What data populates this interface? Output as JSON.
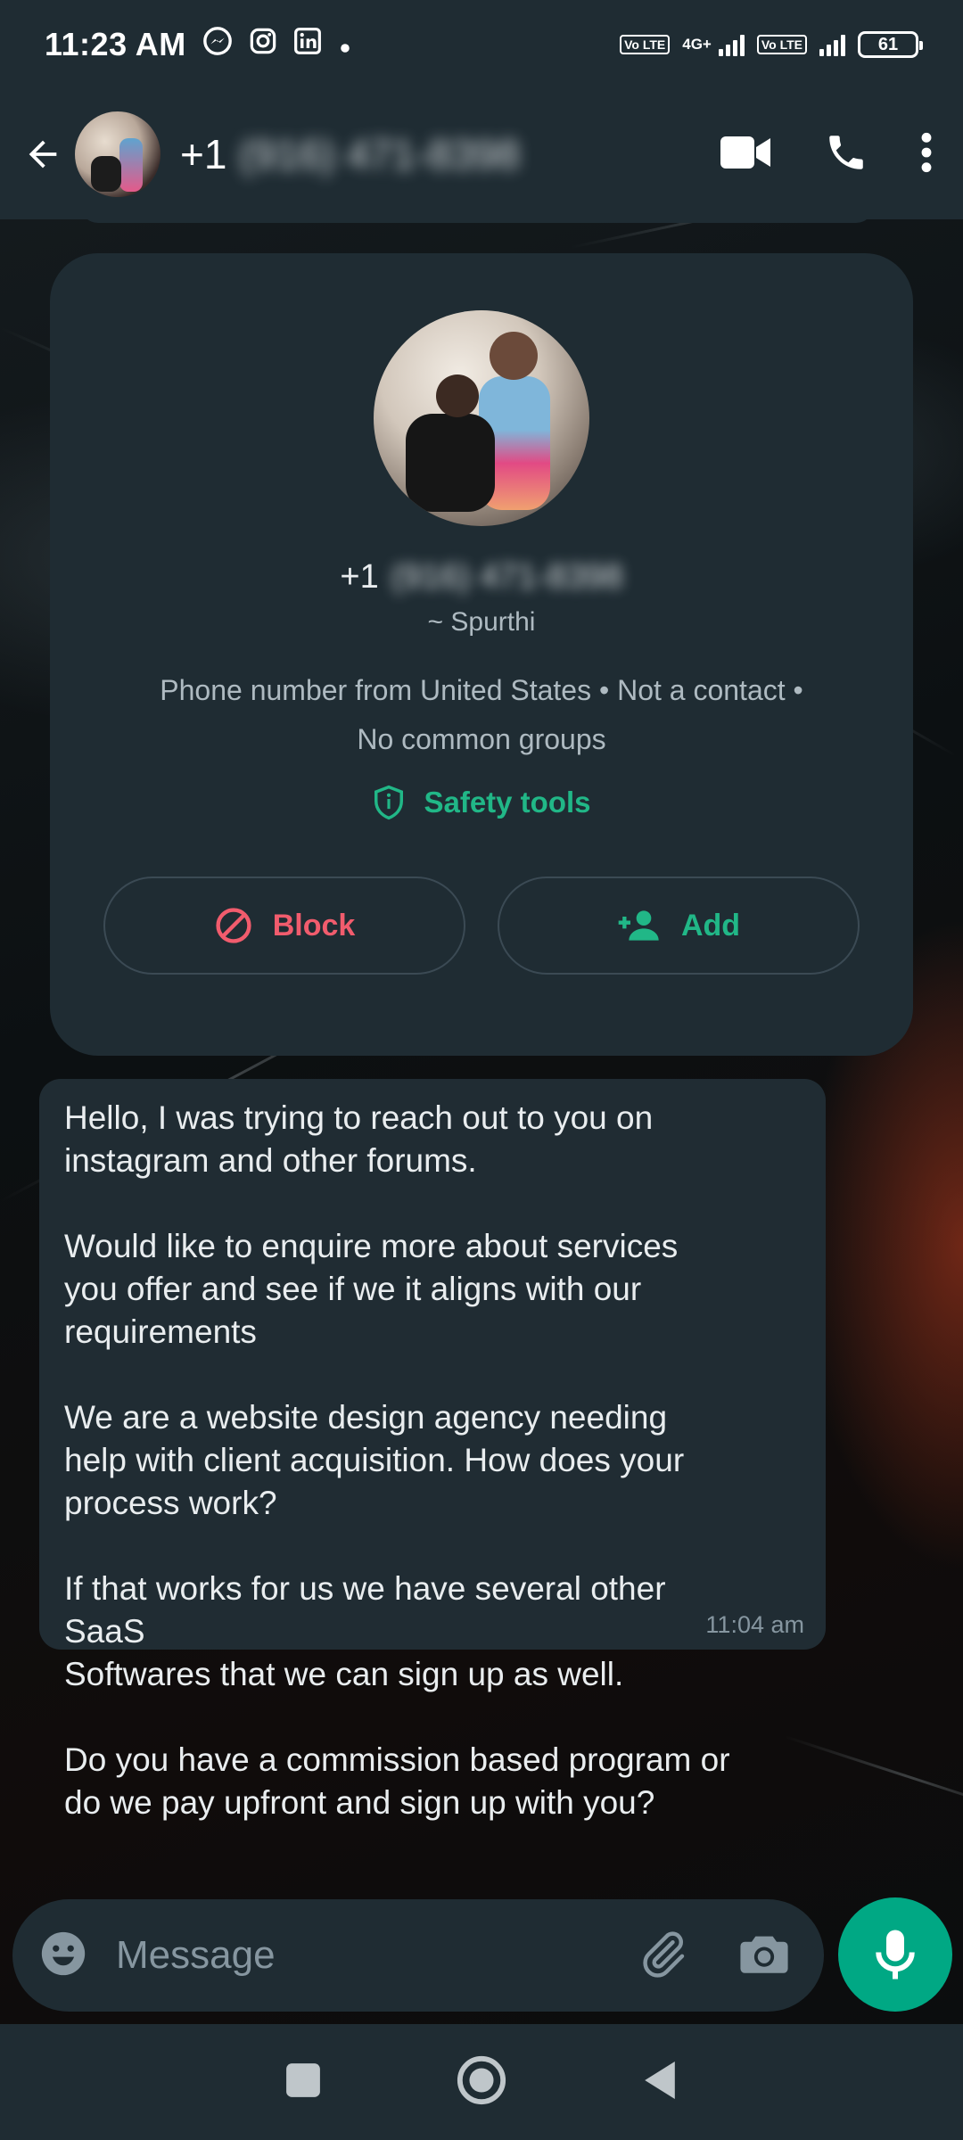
{
  "status_bar": {
    "time": "11:23 AM",
    "battery": "61",
    "network_label": "4G+",
    "lte_label": "Vo LTE"
  },
  "header": {
    "country_code": "+1",
    "phone_blurred": "(916) 471-8398"
  },
  "info_card": {
    "country_code": "+1",
    "phone_blurred": "(916) 471-8398",
    "push_name": "~ Spurthi",
    "meta_line1": "Phone number from United States • Not a contact •",
    "meta_line2": "No common groups",
    "safety_label": "Safety tools",
    "block_label": "Block",
    "add_label": "Add"
  },
  "message": {
    "text": "Hello, I was trying to reach out to you on\ninstagram and other forums.\n\nWould like to enquire more about services\nyou offer and see if we it aligns with our\nrequirements\n\nWe are a website design agency needing\nhelp with client acquisition. How does your\nprocess work?\n\nIf that works for us we have several other\nSaaS\nSoftwares that we can sign up as well.\n\nDo you have a commission based program or\ndo we pay upfront and sign up with you?",
    "time": "11:04 am"
  },
  "composer": {
    "placeholder": "Message"
  },
  "colors": {
    "accent": "#00a884",
    "block_red": "#f15c6d",
    "surface": "#1f2c33"
  }
}
